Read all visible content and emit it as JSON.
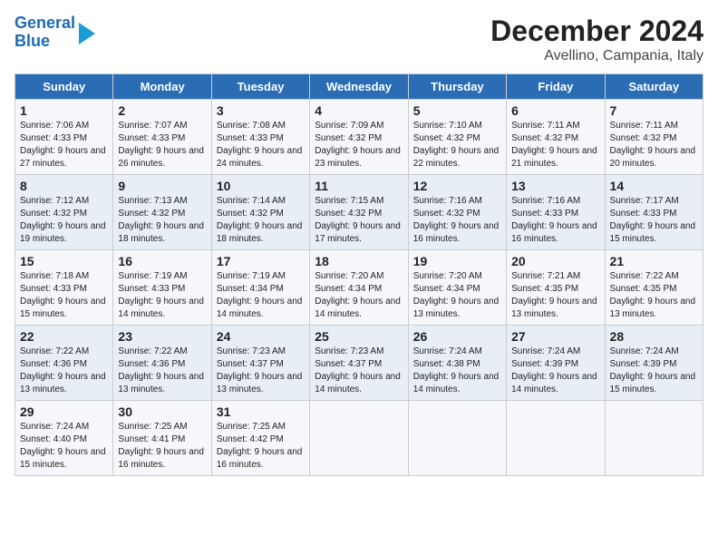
{
  "logo": {
    "line1": "General",
    "line2": "Blue"
  },
  "title": "December 2024",
  "subtitle": "Avellino, Campania, Italy",
  "days_of_week": [
    "Sunday",
    "Monday",
    "Tuesday",
    "Wednesday",
    "Thursday",
    "Friday",
    "Saturday"
  ],
  "weeks": [
    [
      {
        "day": 1,
        "sunrise": "7:06 AM",
        "sunset": "4:33 PM",
        "daylight": "9 hours and 27 minutes."
      },
      {
        "day": 2,
        "sunrise": "7:07 AM",
        "sunset": "4:33 PM",
        "daylight": "9 hours and 26 minutes."
      },
      {
        "day": 3,
        "sunrise": "7:08 AM",
        "sunset": "4:33 PM",
        "daylight": "9 hours and 24 minutes."
      },
      {
        "day": 4,
        "sunrise": "7:09 AM",
        "sunset": "4:32 PM",
        "daylight": "9 hours and 23 minutes."
      },
      {
        "day": 5,
        "sunrise": "7:10 AM",
        "sunset": "4:32 PM",
        "daylight": "9 hours and 22 minutes."
      },
      {
        "day": 6,
        "sunrise": "7:11 AM",
        "sunset": "4:32 PM",
        "daylight": "9 hours and 21 minutes."
      },
      {
        "day": 7,
        "sunrise": "7:11 AM",
        "sunset": "4:32 PM",
        "daylight": "9 hours and 20 minutes."
      }
    ],
    [
      {
        "day": 8,
        "sunrise": "7:12 AM",
        "sunset": "4:32 PM",
        "daylight": "9 hours and 19 minutes."
      },
      {
        "day": 9,
        "sunrise": "7:13 AM",
        "sunset": "4:32 PM",
        "daylight": "9 hours and 18 minutes."
      },
      {
        "day": 10,
        "sunrise": "7:14 AM",
        "sunset": "4:32 PM",
        "daylight": "9 hours and 18 minutes."
      },
      {
        "day": 11,
        "sunrise": "7:15 AM",
        "sunset": "4:32 PM",
        "daylight": "9 hours and 17 minutes."
      },
      {
        "day": 12,
        "sunrise": "7:16 AM",
        "sunset": "4:32 PM",
        "daylight": "9 hours and 16 minutes."
      },
      {
        "day": 13,
        "sunrise": "7:16 AM",
        "sunset": "4:33 PM",
        "daylight": "9 hours and 16 minutes."
      },
      {
        "day": 14,
        "sunrise": "7:17 AM",
        "sunset": "4:33 PM",
        "daylight": "9 hours and 15 minutes."
      }
    ],
    [
      {
        "day": 15,
        "sunrise": "7:18 AM",
        "sunset": "4:33 PM",
        "daylight": "9 hours and 15 minutes."
      },
      {
        "day": 16,
        "sunrise": "7:19 AM",
        "sunset": "4:33 PM",
        "daylight": "9 hours and 14 minutes."
      },
      {
        "day": 17,
        "sunrise": "7:19 AM",
        "sunset": "4:34 PM",
        "daylight": "9 hours and 14 minutes."
      },
      {
        "day": 18,
        "sunrise": "7:20 AM",
        "sunset": "4:34 PM",
        "daylight": "9 hours and 14 minutes."
      },
      {
        "day": 19,
        "sunrise": "7:20 AM",
        "sunset": "4:34 PM",
        "daylight": "9 hours and 13 minutes."
      },
      {
        "day": 20,
        "sunrise": "7:21 AM",
        "sunset": "4:35 PM",
        "daylight": "9 hours and 13 minutes."
      },
      {
        "day": 21,
        "sunrise": "7:22 AM",
        "sunset": "4:35 PM",
        "daylight": "9 hours and 13 minutes."
      }
    ],
    [
      {
        "day": 22,
        "sunrise": "7:22 AM",
        "sunset": "4:36 PM",
        "daylight": "9 hours and 13 minutes."
      },
      {
        "day": 23,
        "sunrise": "7:22 AM",
        "sunset": "4:36 PM",
        "daylight": "9 hours and 13 minutes."
      },
      {
        "day": 24,
        "sunrise": "7:23 AM",
        "sunset": "4:37 PM",
        "daylight": "9 hours and 13 minutes."
      },
      {
        "day": 25,
        "sunrise": "7:23 AM",
        "sunset": "4:37 PM",
        "daylight": "9 hours and 14 minutes."
      },
      {
        "day": 26,
        "sunrise": "7:24 AM",
        "sunset": "4:38 PM",
        "daylight": "9 hours and 14 minutes."
      },
      {
        "day": 27,
        "sunrise": "7:24 AM",
        "sunset": "4:39 PM",
        "daylight": "9 hours and 14 minutes."
      },
      {
        "day": 28,
        "sunrise": "7:24 AM",
        "sunset": "4:39 PM",
        "daylight": "9 hours and 15 minutes."
      }
    ],
    [
      {
        "day": 29,
        "sunrise": "7:24 AM",
        "sunset": "4:40 PM",
        "daylight": "9 hours and 15 minutes."
      },
      {
        "day": 30,
        "sunrise": "7:25 AM",
        "sunset": "4:41 PM",
        "daylight": "9 hours and 16 minutes."
      },
      {
        "day": 31,
        "sunrise": "7:25 AM",
        "sunset": "4:42 PM",
        "daylight": "9 hours and 16 minutes."
      },
      null,
      null,
      null,
      null
    ]
  ]
}
